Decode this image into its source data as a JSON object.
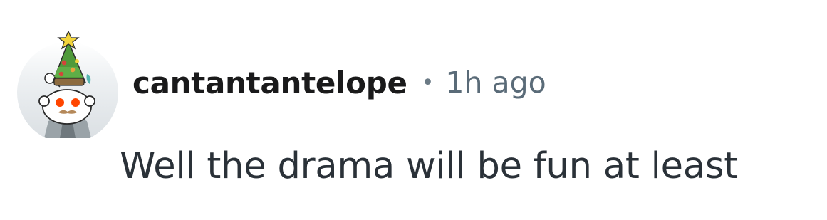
{
  "comment": {
    "author": "cantantantelope",
    "separator": "•",
    "time": "1h ago",
    "text": "Well the drama will be fun at least",
    "avatar_icon": "snoo-avatar-with-christmas-tree-hat-icon"
  },
  "colors": {
    "username": "#1a1a1b",
    "meta": "#5a6b78",
    "body_text": "#2a3138",
    "avatar_bg": "#e3e7ea",
    "tree_green": "#4f9a3a",
    "star_yellow": "#f2d43b",
    "eye_orange": "#ff4500"
  }
}
